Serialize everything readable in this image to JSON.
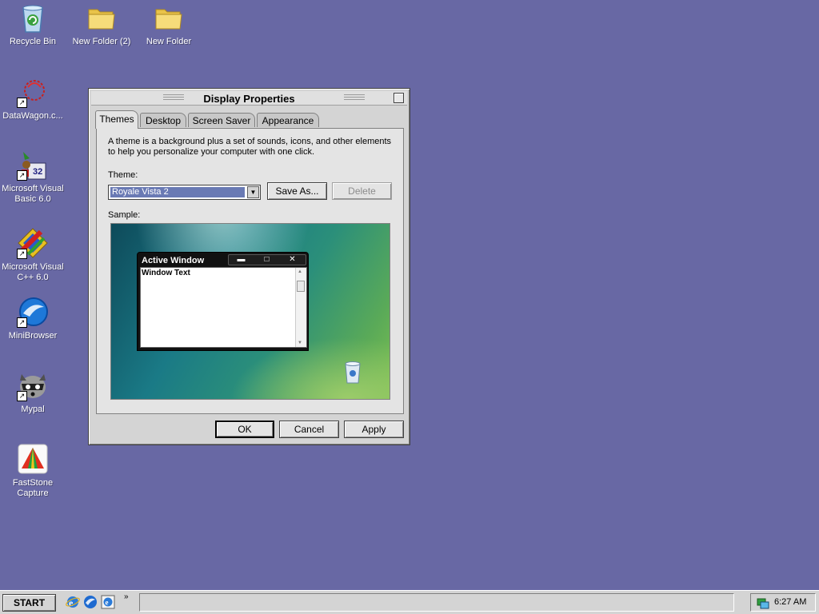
{
  "desktop": {
    "icons": [
      {
        "label": "Recycle Bin",
        "icon": "recycle-bin-icon"
      },
      {
        "label": "New Folder (2)",
        "icon": "folder-icon"
      },
      {
        "label": "New Folder",
        "icon": "folder-icon"
      },
      {
        "label": "DataWagon.c...",
        "icon": "datawagon-icon"
      },
      {
        "label": "Microsoft Visual Basic 6.0",
        "icon": "visual-basic-icon"
      },
      {
        "label": "Microsoft Visual C++ 6.0",
        "icon": "visual-cpp-icon"
      },
      {
        "label": "MiniBrowser",
        "icon": "minibrowser-icon"
      },
      {
        "label": "Mypal",
        "icon": "mypal-icon"
      },
      {
        "label": "FastStone Capture",
        "icon": "faststone-capture-icon"
      }
    ]
  },
  "dialog": {
    "title": "Display Properties",
    "tabs": [
      "Themes",
      "Desktop",
      "Screen Saver",
      "Appearance"
    ],
    "active_tab": "Themes",
    "description": "A theme is a background plus a set of sounds, icons, and other elements to help you personalize your computer with one click.",
    "theme_label": "Theme:",
    "theme_value": "Royale Vista 2",
    "save_as_label": "Save As...",
    "delete_label": "Delete",
    "sample_label": "Sample:",
    "sample": {
      "window_title": "Active Window",
      "window_text": "Window Text"
    },
    "ok_label": "OK",
    "cancel_label": "Cancel",
    "apply_label": "Apply"
  },
  "taskbar": {
    "start_label": "START",
    "quick_launch": [
      "internet-explorer-icon",
      "browser-globe-icon",
      "ie-shortcut-icon"
    ],
    "chevron": "»",
    "clock": "6:27 AM"
  },
  "colors": {
    "desktop_background": "#6868a4",
    "selection": "#6a7ab4"
  }
}
